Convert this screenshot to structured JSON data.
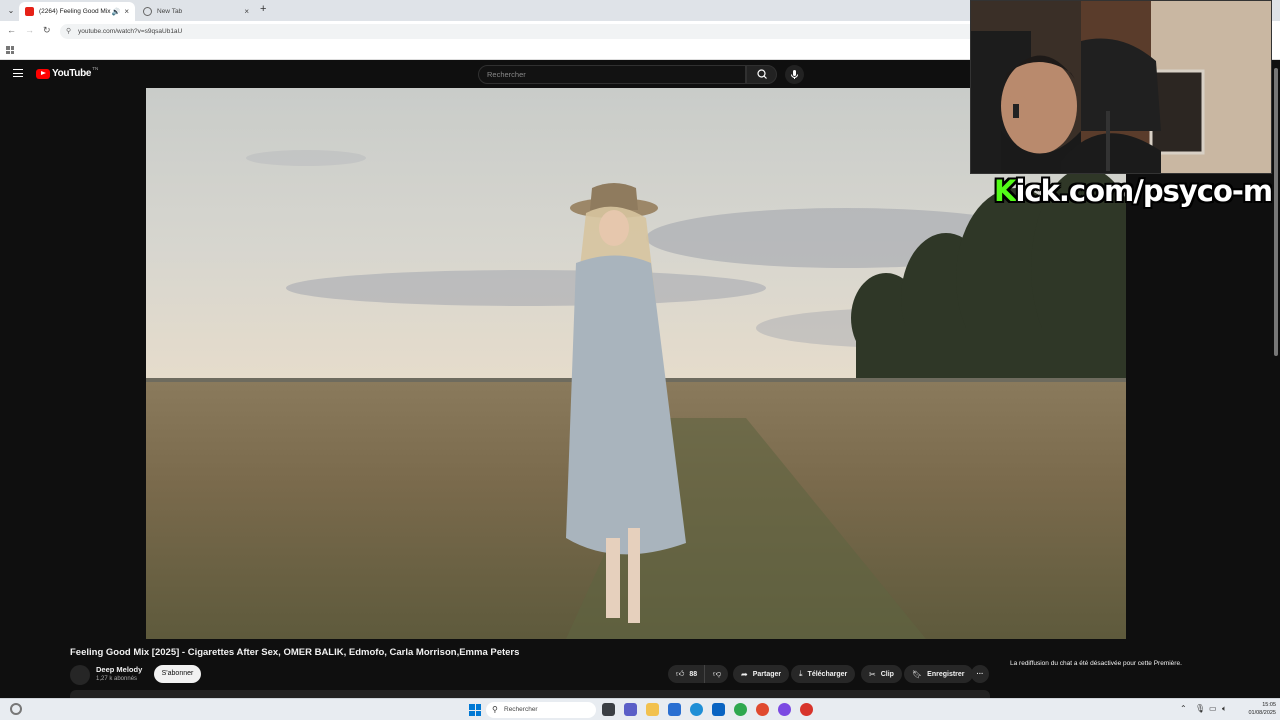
{
  "browser": {
    "tabs": [
      {
        "title": "(2264) Feeling Good Mix [2..."
      },
      {
        "title": "New Tab"
      }
    ],
    "new_tab_label": "+",
    "close_label": "×",
    "url": "youtube.com/watch?v=s9qsaUb1aU"
  },
  "youtube": {
    "logo_text": "YouTube",
    "logo_suffix": "TN",
    "search_placeholder": "Rechercher",
    "video": {
      "title": "Feeling Good Mix [2025] - Cigarettes After Sex, OMER BALIK, Edmofo, Carla Morrison,Emma Peters",
      "channel": "Deep Melody",
      "subscribers": "1,27 k abonnés",
      "subscribe_label": "S'abonner",
      "likes": "88",
      "share_label": "Partager",
      "download_label": "Télécharger",
      "clip_label": "Clip",
      "save_label": "Enregistrer",
      "more_label": "···"
    },
    "chat_note": "La rediffusion du chat a été désactivée pour cette Première."
  },
  "overlay": {
    "kick_first": "K",
    "kick_rest": "ick.com/psyco-m"
  },
  "taskbar": {
    "search_placeholder": "Rechercher",
    "time": "15:05",
    "date": "01/08/2025"
  },
  "colors": {
    "youtube_red": "#ff0000",
    "kick_green": "#53fc18",
    "page_bg": "#0f0f0f"
  }
}
